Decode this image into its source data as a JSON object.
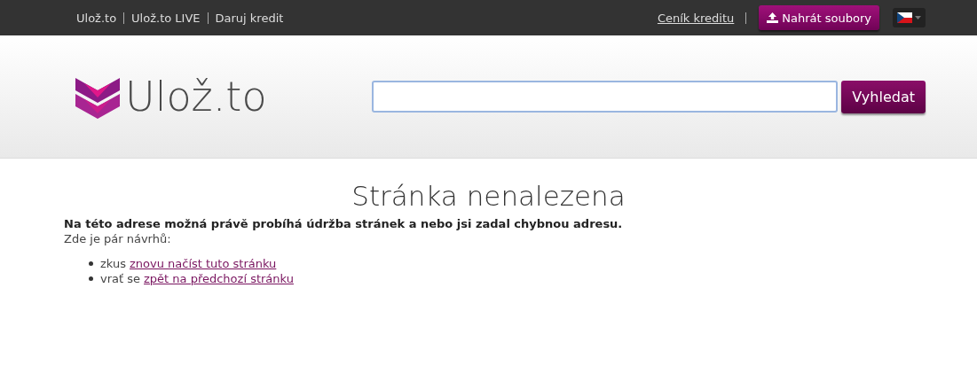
{
  "top_nav": {
    "links": [
      "Ulož.to",
      "Ulož.to LIVE",
      "Daruj kredit"
    ],
    "pricing_link": "Ceník kreditu",
    "upload_button": "Nahrát soubory"
  },
  "header": {
    "logo_text": "Ulož.to",
    "search_button": "Vyhledat"
  },
  "error": {
    "title": "Stránka nenalezena",
    "message": "Na této adrese možná právě probíhá údržba stránek a nebo jsi zadal chybnou adresu.",
    "hint": "Zde je pár návrhů:",
    "suggestions": [
      {
        "prefix": "zkus",
        "link": "znovu načíst tuto stránku"
      },
      {
        "prefix": "vrať se",
        "link": "zpět na předchozí stránku"
      }
    ]
  }
}
